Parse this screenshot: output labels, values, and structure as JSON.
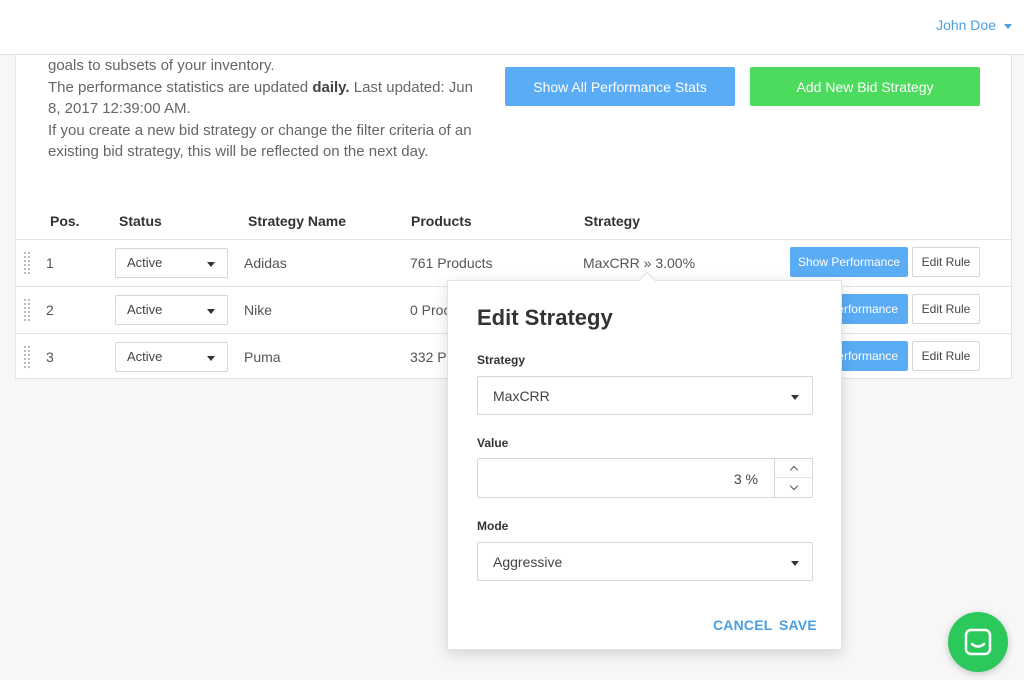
{
  "header": {
    "user_name": "John Doe"
  },
  "intro": {
    "line1": "goals to subsets of your inventory.",
    "updated_prefix": "The performance statistics are updated ",
    "updated_bold": "daily.",
    "updated_suffix": " Last updated: Jun 8, 2017 12:39:00 AM.",
    "note": "If you create a new bid strategy or change the filter criteria of an existing bid strategy, this will be reflected on the next day."
  },
  "actions": {
    "show_stats": "Show All Performance Stats",
    "add_strategy": "Add New Bid Strategy"
  },
  "table": {
    "headers": {
      "pos": "Pos.",
      "status": "Status",
      "name": "Strategy Name",
      "products": "Products",
      "strategy": "Strategy"
    },
    "rows": [
      {
        "pos": "1",
        "status": "Active",
        "name": "Adidas",
        "products": "761 Products",
        "strategy": "MaxCRR » 3.00%",
        "perf": "Show Performance",
        "edit": "Edit Rule"
      },
      {
        "pos": "2",
        "status": "Active",
        "name": "Nike",
        "products": "0 Proc",
        "strategy": "",
        "perf": "erformance",
        "edit": "Edit Rule"
      },
      {
        "pos": "3",
        "status": "Active",
        "name": "Puma",
        "products": "332 P",
        "strategy": "",
        "perf": "erformance",
        "edit": "Edit Rule"
      }
    ]
  },
  "popover": {
    "title": "Edit Strategy",
    "strategy_label": "Strategy",
    "strategy_value": "MaxCRR",
    "value_label": "Value",
    "value_value": "3 %",
    "mode_label": "Mode",
    "mode_value": "Aggressive",
    "cancel": "CANCEL",
    "save": "SAVE"
  },
  "colors": {
    "accent_blue": "#5aacf5",
    "add_green": "#4cdb5c",
    "chat_green": "#2bc95b",
    "link_blue": "#4a9fe3"
  },
  "icons": {
    "user_menu": "caret-down-icon",
    "row_drag": "drag-handle-icon",
    "select": "caret-down-icon",
    "stepper_up": "chevron-up-icon",
    "stepper_down": "chevron-down-icon",
    "chat": "chat-icon"
  }
}
